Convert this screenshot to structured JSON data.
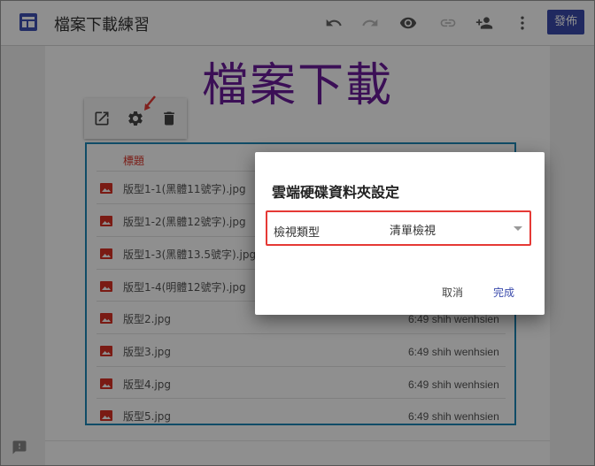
{
  "app": {
    "doc_title": "檔案下載練習",
    "publish_label": "發佈"
  },
  "toolbar_icons": [
    "undo-icon",
    "redo-icon",
    "preview-icon",
    "link-icon",
    "add-person-icon",
    "more-vert-icon"
  ],
  "page": {
    "heading": "檔案下載"
  },
  "embed_toolbar": [
    "open-external-icon",
    "settings-gear-icon",
    "delete-icon"
  ],
  "file_list": {
    "column_header": "標題",
    "rows": [
      {
        "name": "版型1-1(黑體11號字).jpg",
        "meta": ""
      },
      {
        "name": "版型1-2(黑體12號字).jpg",
        "meta": ""
      },
      {
        "name": "版型1-3(黑體13.5號字).jpg",
        "meta": ""
      },
      {
        "name": "版型1-4(明體12號字).jpg",
        "meta": ""
      },
      {
        "name": "版型2.jpg",
        "meta": "6:49  shih wenhsien"
      },
      {
        "name": "版型3.jpg",
        "meta": "6:49  shih wenhsien"
      },
      {
        "name": "版型4.jpg",
        "meta": "6:49  shih wenhsien"
      },
      {
        "name": "版型5.jpg",
        "meta": "6:49  shih wenhsien"
      }
    ]
  },
  "dialog": {
    "title": "雲端硬碟資料夾設定",
    "view_type_label": "檢視類型",
    "view_type_value": "清單檢視",
    "cancel_label": "取消",
    "done_label": "完成"
  },
  "colors": {
    "accent": "#3949ab",
    "heading": "#6a1b9a",
    "highlight": "#e53935",
    "embed_border": "#1e88b8"
  }
}
